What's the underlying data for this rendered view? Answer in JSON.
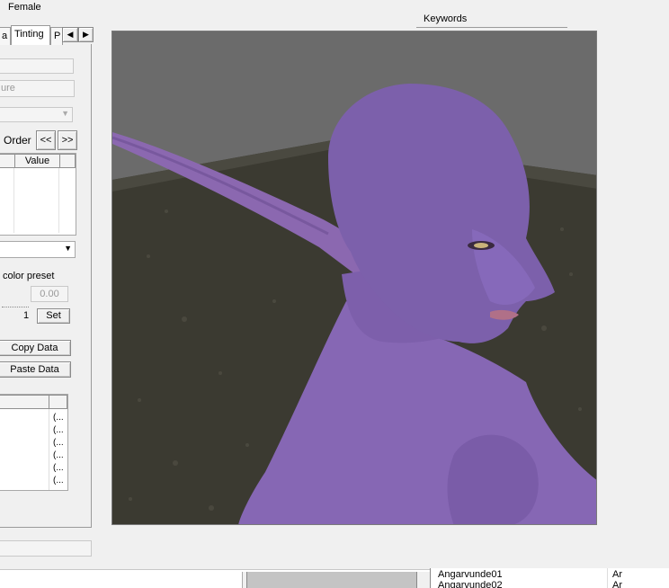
{
  "header": {
    "gender_label": "Female",
    "keywords_label": "Keywords"
  },
  "tabs": [
    {
      "label": "a"
    },
    {
      "label": "Tinting"
    },
    {
      "label": "P"
    }
  ],
  "tab_scroll": {
    "left": "◀",
    "right": "▶"
  },
  "left_panel": {
    "disabled_button": "ure",
    "order_label": "Order",
    "prev_button": "<<",
    "next_button": ">>",
    "value_table": {
      "columns": [
        "",
        "Value"
      ]
    },
    "color_preset_label": "color preset",
    "color_value": "0.00",
    "set_count": "1",
    "set_button": "Set",
    "copy_data_button": "Copy Data",
    "paste_data_button": "Paste Data",
    "list_rows": [
      "(...",
      "(...",
      "(...",
      "(...",
      "(...",
      "(..."
    ]
  },
  "bottom_list": {
    "rows": [
      {
        "name": "Angarvunde01",
        "col2": "Ar"
      },
      {
        "name": "Angarvunde02",
        "col2": "Ar"
      }
    ]
  },
  "viewport": {
    "description_icon": "character-preview-3d",
    "skin_color": "#7a5ea6",
    "floor_color": "#3a3a30",
    "wall_color": "#6b6b6b"
  }
}
